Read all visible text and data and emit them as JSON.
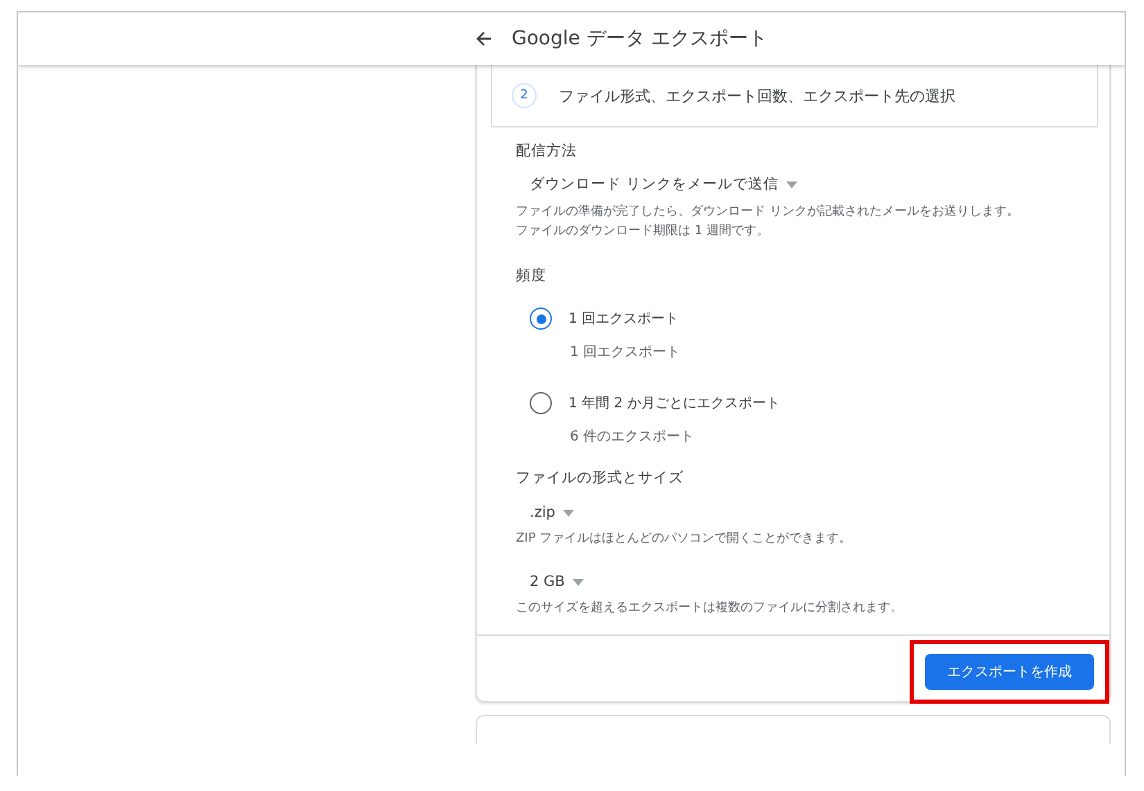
{
  "header": {
    "title": "Google データ エクスポート"
  },
  "step": {
    "number": "2",
    "title": "ファイル形式、エクスポート回数、エクスポート先の選択"
  },
  "delivery": {
    "label": "配信方法",
    "dropdown": "ダウンロード リンクをメールで送信",
    "description": [
      "ファイルの準備が完了したら、ダウンロード リンクが記載されたメールをお送りします。",
      "ファイルのダウンロード期限は 1 週間です。"
    ]
  },
  "frequency": {
    "label": "頻度",
    "options": [
      {
        "label": "1 回エクスポート",
        "detail": "1 回エクスポート",
        "selected": true
      },
      {
        "label": "1 年間 2 か月ごとにエクスポート",
        "detail": "6 件のエクスポート",
        "selected": false
      }
    ]
  },
  "file_format": {
    "label": "ファイルの形式とサイズ",
    "selects": [
      {
        "value": ".zip",
        "description": "ZIP ファイルはほとんどのパソコンで開くことができます。"
      },
      {
        "value": "2 GB",
        "description": "このサイズを超えるエクスポートは複数のファイルに分割されます。"
      }
    ]
  },
  "create_button": {
    "label": "エクスポートを作成",
    "highlighted": true
  }
}
